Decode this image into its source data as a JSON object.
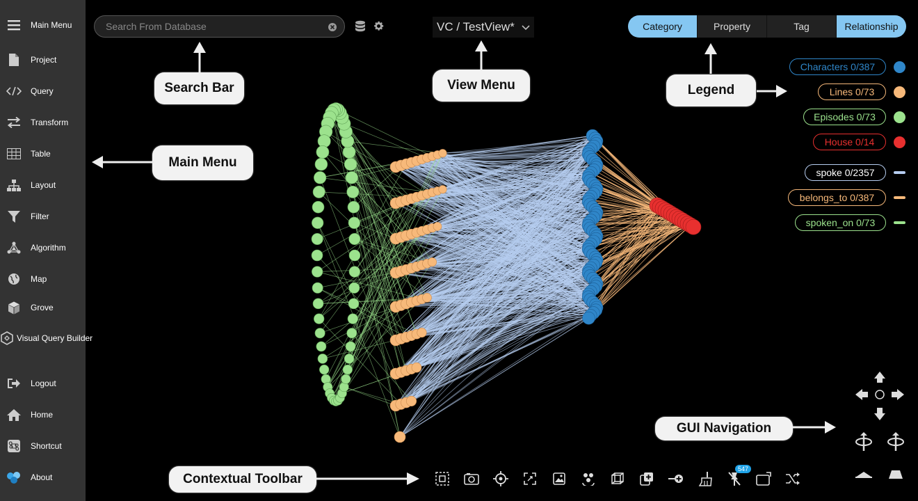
{
  "sidebar": {
    "items": [
      {
        "label": "Main Menu",
        "icon": "hamburger-icon"
      },
      {
        "label": "Project",
        "icon": "document-icon"
      },
      {
        "label": "Query",
        "icon": "code-icon"
      },
      {
        "label": "Transform",
        "icon": "swap-icon"
      },
      {
        "label": "Table",
        "icon": "table-icon"
      },
      {
        "label": "Layout",
        "icon": "hierarchy-icon"
      },
      {
        "label": "Filter",
        "icon": "funnel-icon"
      },
      {
        "label": "Algorithm",
        "icon": "network-icon"
      },
      {
        "label": "Map",
        "icon": "globe-icon"
      },
      {
        "label": "Grove",
        "icon": "cube-icon"
      },
      {
        "label": "Visual Query Builder",
        "icon": "hexagon-icon"
      },
      {
        "label": "Logout",
        "icon": "logout-icon"
      },
      {
        "label": "Home",
        "icon": "home-icon"
      },
      {
        "label": "Shortcut",
        "icon": "command-icon"
      },
      {
        "label": "About",
        "icon": "about-icon"
      }
    ]
  },
  "search": {
    "placeholder": "Search From Database"
  },
  "view": {
    "title": "VC / TestView*"
  },
  "legend": {
    "tabs": [
      {
        "label": "Category",
        "active": true
      },
      {
        "label": "Property",
        "active": false
      },
      {
        "label": "Tag",
        "active": false
      },
      {
        "label": "Relationship",
        "active": true
      }
    ],
    "nodes": [
      {
        "label": "Characters 0/387",
        "color": "#2f86c9"
      },
      {
        "label": "Lines 0/73",
        "color": "#f7b97a"
      },
      {
        "label": "Episodes 0/73",
        "color": "#9ce28d"
      },
      {
        "label": "House 0/14",
        "color": "#e8302f"
      }
    ],
    "edges": [
      {
        "label": "spoke 0/2357",
        "color": "#b6cdf0"
      },
      {
        "label": "belongs_to 0/387",
        "color": "#f7b97a"
      },
      {
        "label": "spoken_on 0/73",
        "color": "#9ce28d"
      }
    ]
  },
  "callouts": {
    "search_bar": "Search Bar",
    "view_menu": "View Menu",
    "legend": "Legend",
    "main_menu": "Main Menu",
    "gui_navigation": "GUI Navigation",
    "contextual_toolbar": "Contextual Toolbar"
  },
  "toolbar": {
    "tools": [
      "select-icon",
      "camera-icon",
      "crosshair-icon",
      "fit-icon",
      "image-icon",
      "group-icon",
      "cube-frame-icon",
      "add-node-icon",
      "connect-icon",
      "brush-icon",
      "pin-off-icon",
      "window-icon",
      "shuffle-icon"
    ],
    "badge": "547"
  },
  "colors": {
    "characters": "#2f86c9",
    "lines": "#f7b97a",
    "episodes": "#9ce28d",
    "house": "#e8302f",
    "spoke": "#b6cdf0"
  }
}
